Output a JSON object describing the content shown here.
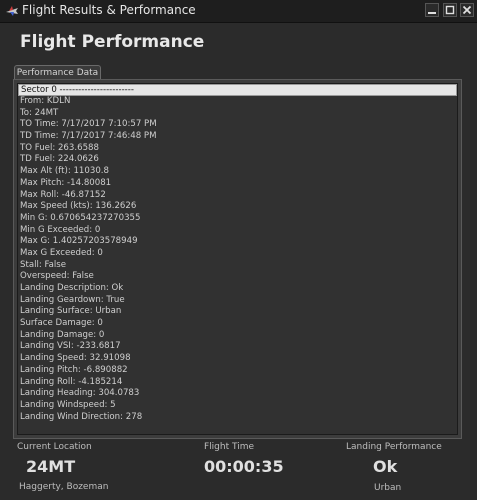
{
  "window": {
    "title": "Flight Results & Performance"
  },
  "page_title": "Flight Performance",
  "tab": {
    "label": "Performance Data"
  },
  "performance_rows": [
    "Sector 0 ------------------------",
    "From: KDLN",
    "To: 24MT",
    "TO Time: 7/17/2017 7:10:57 PM",
    "TD Time: 7/17/2017 7:46:48 PM",
    "TO Fuel: 263.6588",
    "TD Fuel: 224.0626",
    "Max Alt (ft): 11030.8",
    "Max Pitch: -14.80081",
    "Max Roll: -46.87152",
    "Max Speed (kts): 136.2626",
    "Min G: 0.670654237270355",
    "Min G Exceeded: 0",
    "Max G: 1.40257203578949",
    "Max G Exceeded: 0",
    "Stall: False",
    "Overspeed: False",
    "Landing Description: Ok",
    "Landing Geardown: True",
    "Landing Surface: Urban",
    "Surface Damage: 0",
    "Landing Damage: 0",
    "Landing VSI: -233.6817",
    "Landing Speed: 32.91098",
    "Landing Pitch: -6.890882",
    "Landing Roll: -4.185214",
    "Landing Heading: 304.0783",
    "Landing Windspeed: 5",
    "Landing Wind Direction: 278"
  ],
  "footer": {
    "current_location": {
      "label": "Current Location",
      "value": "24MT",
      "sub": "Haggerty, Bozeman"
    },
    "flight_time": {
      "label": "Flight Time",
      "value": "00:00:35"
    },
    "landing_performance": {
      "label": "Landing Performance",
      "value": "Ok",
      "sub": "Urban"
    }
  },
  "icons": {
    "app": "plane-icon",
    "minimize": "minimize-icon",
    "maximize": "maximize-icon",
    "close": "close-icon"
  },
  "colors": {
    "window_bg": "#2b2b2b",
    "titlebar_bg": "#1e1e1e",
    "list_bg": "#313131",
    "selected_row_bg": "#e6e6e6"
  }
}
